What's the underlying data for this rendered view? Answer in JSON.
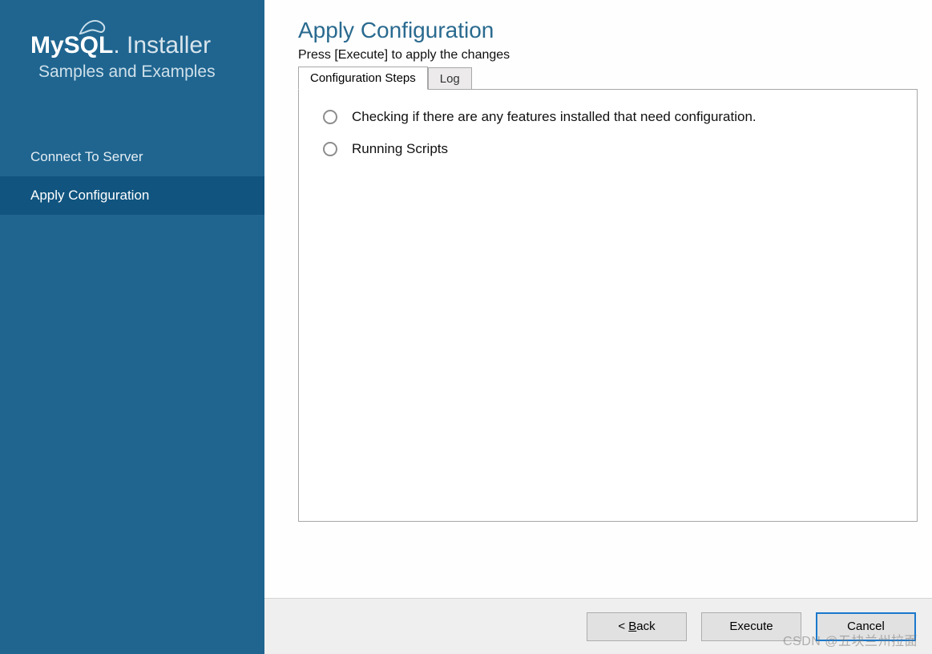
{
  "sidebar": {
    "logo_bold": "MySQL",
    "logo_light": "Installer",
    "subtitle": "Samples and Examples",
    "items": [
      {
        "label": "Connect To Server",
        "active": false
      },
      {
        "label": "Apply Configuration",
        "active": true
      }
    ]
  },
  "main": {
    "title": "Apply Configuration",
    "subtext": "Press [Execute] to apply the changes",
    "tabs": [
      {
        "label": "Configuration Steps",
        "active": true
      },
      {
        "label": "Log",
        "active": false
      }
    ],
    "steps": [
      {
        "label": "Checking if there are any features installed that need configuration."
      },
      {
        "label": "Running Scripts"
      }
    ]
  },
  "footer": {
    "back": "< Back",
    "execute": "Execute",
    "cancel": "Cancel"
  },
  "watermark": "CSDN @五块兰州拉面"
}
